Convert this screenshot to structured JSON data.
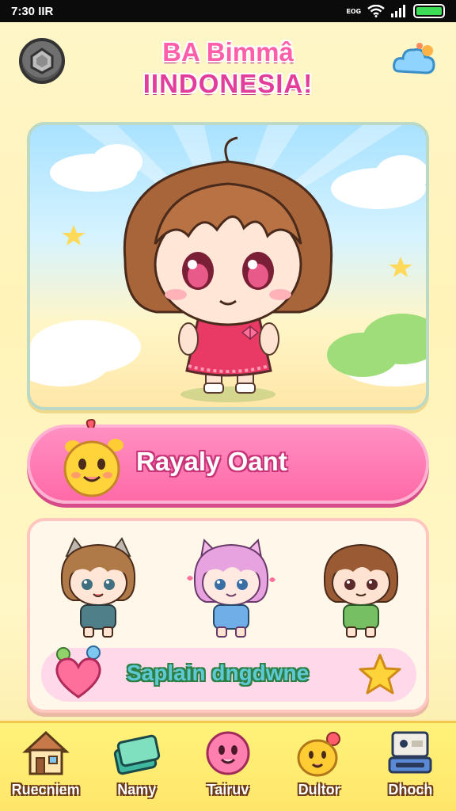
{
  "status_bar": {
    "time": "7:30 IIR",
    "icons_text": "ᴇᴏɢ"
  },
  "header": {
    "title_line1": "BA Bimmâ",
    "title_line2": "IINDONESIA!"
  },
  "icons": {
    "back": "gear-back-icon",
    "cloud": "cloud-icon",
    "mascot": "sun-mascot-icon",
    "heart": "heart-icon",
    "star": "star-icon"
  },
  "name_bar": {
    "label": "Rayaly Oant"
  },
  "characters": [
    {
      "name": "cat-ear-brown-boy",
      "shirt": "#4f7f88"
    },
    {
      "name": "pink-hair-girl",
      "shirt": "#6faee6"
    },
    {
      "name": "brown-hair-boy",
      "shirt": "#76bf62"
    }
  ],
  "sub_bar": {
    "label": "Saplain dngdwne"
  },
  "bottom_nav": {
    "items": [
      {
        "label": "Ruecniem",
        "icon": "house-icon"
      },
      {
        "label": "Namy",
        "icon": "cards-icon"
      },
      {
        "label": "Tairuv",
        "icon": "pink-blob-icon"
      },
      {
        "label": "Dultor",
        "icon": "chick-icon"
      },
      {
        "label": "Dhoch",
        "icon": "device-icon"
      }
    ]
  },
  "colors": {
    "accent_pink": "#ff6aa7",
    "title_pink": "#ff5fa8",
    "nav_yellow": "#ffe66a"
  }
}
